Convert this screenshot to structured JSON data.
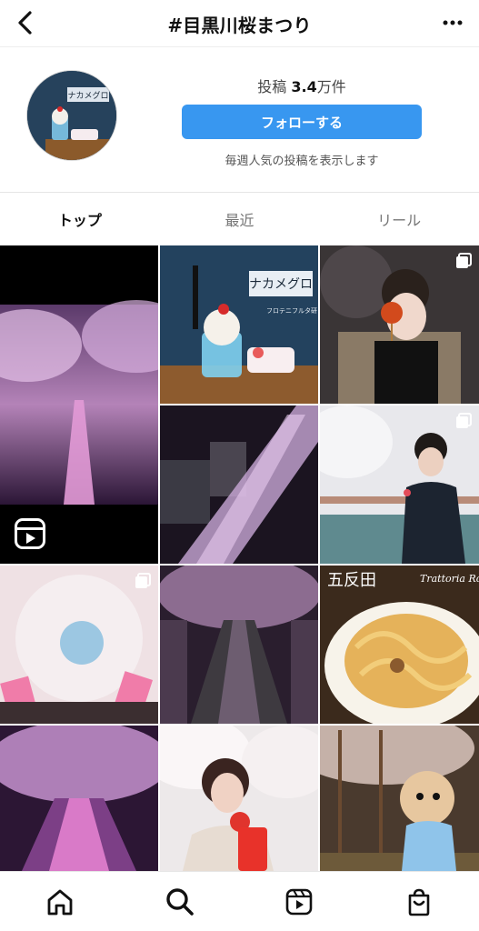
{
  "header": {
    "title": "#目黒川桜まつり"
  },
  "profile": {
    "posts_label": "投稿",
    "posts_count": "3.4",
    "posts_unit": "万件",
    "follow_label": "フォローする",
    "subtitle": "毎週人気の投稿を表示します",
    "avatar_sign": "ナカメグロ"
  },
  "tabs": [
    {
      "label": "トップ",
      "active": true
    },
    {
      "label": "最近"
    },
    {
      "label": "リール"
    }
  ],
  "grid": {
    "tile_texts": {
      "cafe_sign": "ナカメグロ",
      "cafe_sub": "フロテニフルタ研",
      "pasta_left": "五反田",
      "pasta_right": "Trattoria Ron"
    }
  },
  "bottom_nav": [
    "home-icon",
    "search-icon",
    "reels-icon",
    "shop-icon"
  ]
}
